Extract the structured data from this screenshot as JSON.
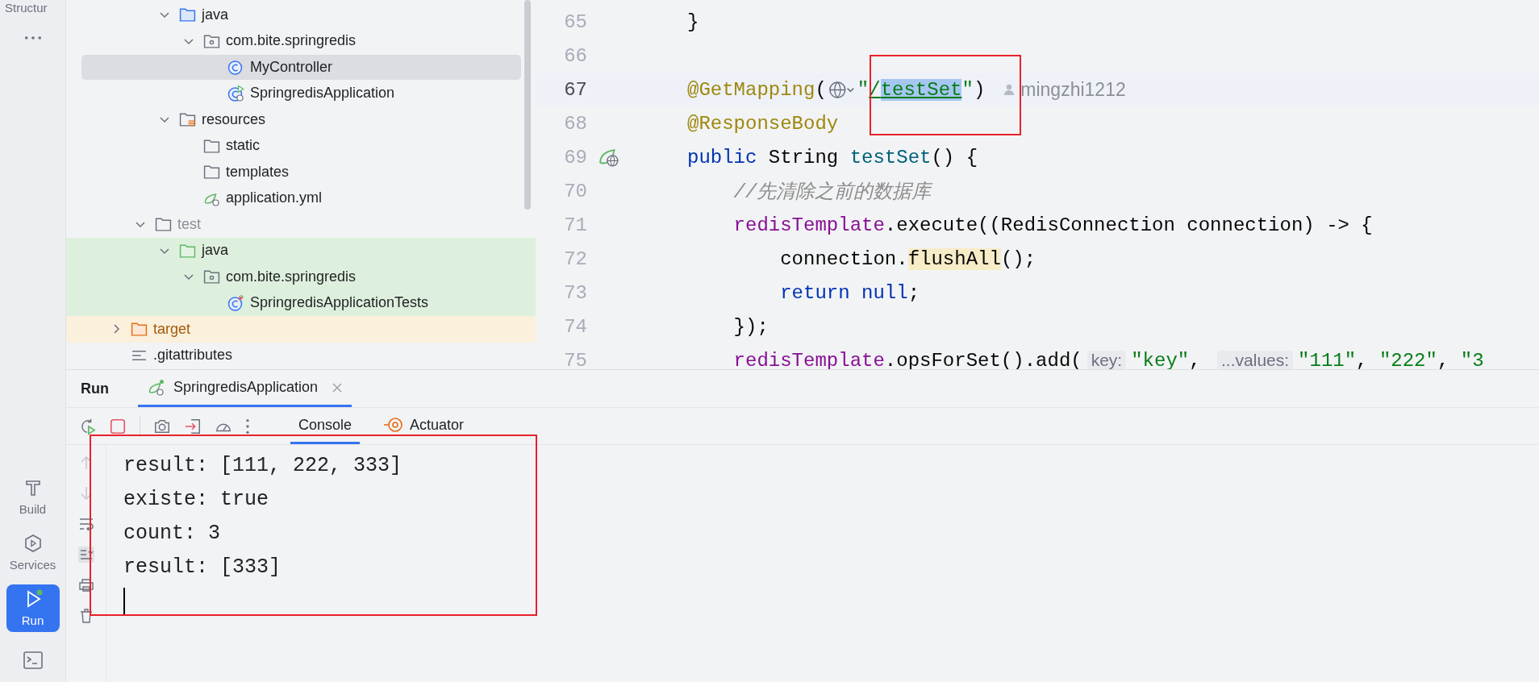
{
  "tool_strip": {
    "title": "Structur",
    "items": [
      {
        "label": "Build",
        "kind": "build",
        "selected": false
      },
      {
        "label": "Services",
        "kind": "services",
        "selected": false
      },
      {
        "label": "Run",
        "kind": "run",
        "selected": true
      }
    ]
  },
  "project_tree": {
    "items": [
      {
        "children": [
          {
            "children": [
              {
                "label": "java",
                "kind": "source-root",
                "expanded": true,
                "selected": false,
                "test_sources": false,
                "excluded": false,
                "children": [
                  {
                    "label": "com.bite.springredis",
                    "kind": "package",
                    "expanded": true,
                    "selected": false,
                    "test_sources": false,
                    "excluded": false,
                    "children": [
                      {
                        "label": "MyController",
                        "kind": "class",
                        "selected": true,
                        "test_sources": false,
                        "excluded": false
                      },
                      {
                        "label": "SpringredisApplication",
                        "kind": "app-class",
                        "selected": false,
                        "test_sources": false,
                        "excluded": false
                      }
                    ]
                  }
                ]
              },
              {
                "label": "resources",
                "kind": "resources-root",
                "expanded": true,
                "selected": false,
                "test_sources": false,
                "excluded": false,
                "children": [
                  {
                    "label": "static",
                    "kind": "folder",
                    "selected": false,
                    "test_sources": false,
                    "excluded": false
                  },
                  {
                    "label": "templates",
                    "kind": "folder",
                    "selected": false,
                    "test_sources": false,
                    "excluded": false
                  },
                  {
                    "label": "application.yml",
                    "kind": "spring-config",
                    "selected": false,
                    "test_sources": false,
                    "excluded": false
                  }
                ]
              }
            ]
          },
          {
            "label": "test",
            "kind": "dimmed-folder",
            "expanded": true,
            "selected": false,
            "test_sources": false,
            "excluded": false,
            "children": [
              {
                "label": "java",
                "kind": "test-root",
                "test_sources": true,
                "excluded": false,
                "expanded": true,
                "selected": false,
                "children": [
                  {
                    "label": "com.bite.springredis",
                    "kind": "package",
                    "test_sources": true,
                    "excluded": false,
                    "expanded": true,
                    "selected": false,
                    "children": [
                      {
                        "label": "SpringredisApplicationTests",
                        "kind": "test-class",
                        "test_sources": true,
                        "excluded": false,
                        "selected": false
                      }
                    ]
                  }
                ]
              }
            ]
          }
        ]
      },
      {
        "label": "target",
        "kind": "excluded-folder",
        "test_sources": false,
        "excluded": true,
        "expanded": false,
        "selected": false
      },
      {
        "label": ".gitattributes",
        "kind": "text-file",
        "test_sources": false,
        "excluded": false,
        "selected": false
      }
    ]
  },
  "editor": {
    "lines": [
      {
        "number": "65",
        "current": false,
        "gutter_marker": false,
        "tokens": [
          {
            "text": "}",
            "kind": "plain"
          }
        ]
      },
      {
        "number": "66",
        "current": false,
        "gutter_marker": false
      },
      {
        "number": "67",
        "current": true,
        "gutter_marker": false,
        "tokens": [
          {
            "text": "@GetMapping",
            "kind": "annotation"
          },
          {
            "text": "(",
            "kind": "plain"
          },
          {
            "kind": "endpoint-menu"
          },
          {
            "text": "\"",
            "kind": "string"
          },
          {
            "text": "/",
            "kind": "link"
          },
          {
            "text": "testSet",
            "kind": "link-selected"
          },
          {
            "text": "\"",
            "kind": "string"
          },
          {
            "text": ")",
            "kind": "plain"
          },
          {
            "text": "mingzhi1212",
            "kind": "author"
          }
        ]
      },
      {
        "number": "68",
        "current": false,
        "gutter_marker": false,
        "tokens": [
          {
            "text": "@ResponseBody",
            "kind": "annotation"
          }
        ]
      },
      {
        "number": "69",
        "current": false,
        "gutter_marker": true,
        "tokens": [
          {
            "text": "public",
            "kind": "keyword"
          },
          {
            "text": " String ",
            "kind": "plain"
          },
          {
            "text": "testSet",
            "kind": "method"
          },
          {
            "text": "() {",
            "kind": "plain"
          }
        ]
      },
      {
        "number": "70",
        "current": false,
        "gutter_marker": false,
        "tokens": [
          {
            "text": "    //先清除之前的数据库",
            "kind": "comment"
          }
        ]
      },
      {
        "number": "71",
        "current": false,
        "gutter_marker": false,
        "tokens": [
          {
            "text": "    redisTemplate",
            "kind": "field"
          },
          {
            "text": ".execute((RedisConnection connection) -> {",
            "kind": "plain"
          }
        ]
      },
      {
        "number": "72",
        "current": false,
        "gutter_marker": false,
        "tokens": [
          {
            "text": "        connection.",
            "kind": "plain"
          },
          {
            "text": "flushAll",
            "kind": "method-highlight"
          },
          {
            "text": "();",
            "kind": "plain"
          }
        ]
      },
      {
        "number": "73",
        "current": false,
        "gutter_marker": false,
        "tokens": [
          {
            "text": "        return",
            "kind": "keyword"
          },
          {
            "text": " null",
            "kind": "keyword"
          },
          {
            "text": ";",
            "kind": "plain"
          }
        ]
      },
      {
        "number": "74",
        "current": false,
        "gutter_marker": false,
        "tokens": [
          {
            "text": "    });",
            "kind": "plain"
          }
        ]
      },
      {
        "number": "75",
        "current": false,
        "gutter_marker": false,
        "tokens": [
          {
            "text": "    redisTemplate",
            "kind": "field"
          },
          {
            "text": ".opsForSet().add(",
            "kind": "plain"
          },
          {
            "text": "key:",
            "kind": "hint"
          },
          {
            "text": "\"key\"",
            "kind": "string"
          },
          {
            "text": ", ",
            "kind": "plain"
          },
          {
            "text": "...values:",
            "kind": "hint"
          },
          {
            "text": "\"111\"",
            "kind": "string"
          },
          {
            "text": ", ",
            "kind": "plain"
          },
          {
            "text": "\"222\"",
            "kind": "string"
          },
          {
            "text": ", ",
            "kind": "plain"
          },
          {
            "text": "\"3",
            "kind": "string"
          }
        ]
      }
    ]
  },
  "run_panel": {
    "title": "Run",
    "tabs": [
      {
        "label": "SpringredisApplication",
        "selected": true
      }
    ],
    "view_tabs": [
      {
        "label": "Console",
        "kind": "console",
        "selected": true
      },
      {
        "label": "Actuator",
        "kind": "actuator",
        "selected": false
      }
    ],
    "console_lines": [
      "result: [111, 222, 333]",
      "existe: true",
      "count: 3",
      "result: [333]"
    ]
  }
}
